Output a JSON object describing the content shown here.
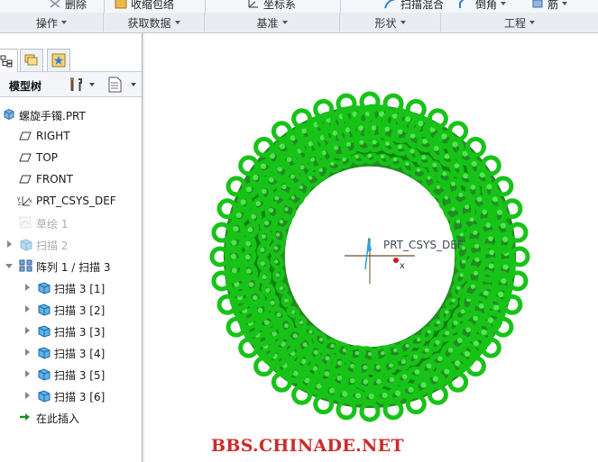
{
  "ribbon": {
    "top_commands": [
      {
        "label": "删除",
        "icon": "delete-icon"
      },
      {
        "label": "收缩包络",
        "icon": "shrinkwrap-icon"
      },
      {
        "label": "坐标系",
        "icon": "csys-icon"
      },
      {
        "label": "扫描混合",
        "icon": "swept-blend-icon"
      },
      {
        "label": "倒角",
        "icon": "chamfer-icon"
      },
      {
        "label": "筋",
        "icon": "rib-icon"
      }
    ],
    "groups": [
      {
        "label": "操作"
      },
      {
        "label": "获取数据"
      },
      {
        "label": "基准"
      },
      {
        "label": "形状"
      },
      {
        "label": "工程"
      }
    ]
  },
  "panel": {
    "title": "模型树",
    "tabs": [
      "model-tree-tab",
      "layer-tree-tab",
      "favorites-tab"
    ]
  },
  "tree": {
    "items": [
      {
        "label": "螺旋手镯.PRT",
        "icon": "part-icon",
        "state": "normal"
      },
      {
        "label": "RIGHT",
        "icon": "datum-plane-icon",
        "state": "normal"
      },
      {
        "label": "TOP",
        "icon": "datum-plane-icon",
        "state": "normal"
      },
      {
        "label": "FRONT",
        "icon": "datum-plane-icon",
        "state": "normal"
      },
      {
        "label": "PRT_CSYS_DEF",
        "icon": "csys-icon",
        "state": "normal"
      },
      {
        "label": "草绘 1",
        "icon": "sketch-icon",
        "state": "hidden"
      },
      {
        "label": "扫描 2",
        "icon": "sweep-icon",
        "state": "hidden"
      },
      {
        "label": "阵列 1 / 扫描 3",
        "icon": "pattern-icon",
        "state": "expanded"
      },
      {
        "label": "扫描 3 [1]",
        "icon": "sweep-icon",
        "state": "normal"
      },
      {
        "label": "扫描 3 [2]",
        "icon": "sweep-icon",
        "state": "normal"
      },
      {
        "label": "扫描 3 [3]",
        "icon": "sweep-icon",
        "state": "normal"
      },
      {
        "label": "扫描 3 [4]",
        "icon": "sweep-icon",
        "state": "normal"
      },
      {
        "label": "扫描 3 [5]",
        "icon": "sweep-icon",
        "state": "normal"
      },
      {
        "label": "扫描 3 [6]",
        "icon": "sweep-icon",
        "state": "normal"
      },
      {
        "label": "在此插入",
        "icon": "insert-here-arrow-icon",
        "state": "normal"
      }
    ]
  },
  "viewport": {
    "csys_label": "PRT_CSYS_DEF",
    "axis_label": "x",
    "model_color": "#17c317",
    "model_dark": "#0a7f0a",
    "model_highlight": "#5ef55e"
  },
  "watermark": "BBS.CHINADE.NET",
  "colors": {
    "ribbon_bg": "#e9edf2",
    "accent_blue": "#2f7fd0",
    "watermark": "#cc2a2a"
  }
}
